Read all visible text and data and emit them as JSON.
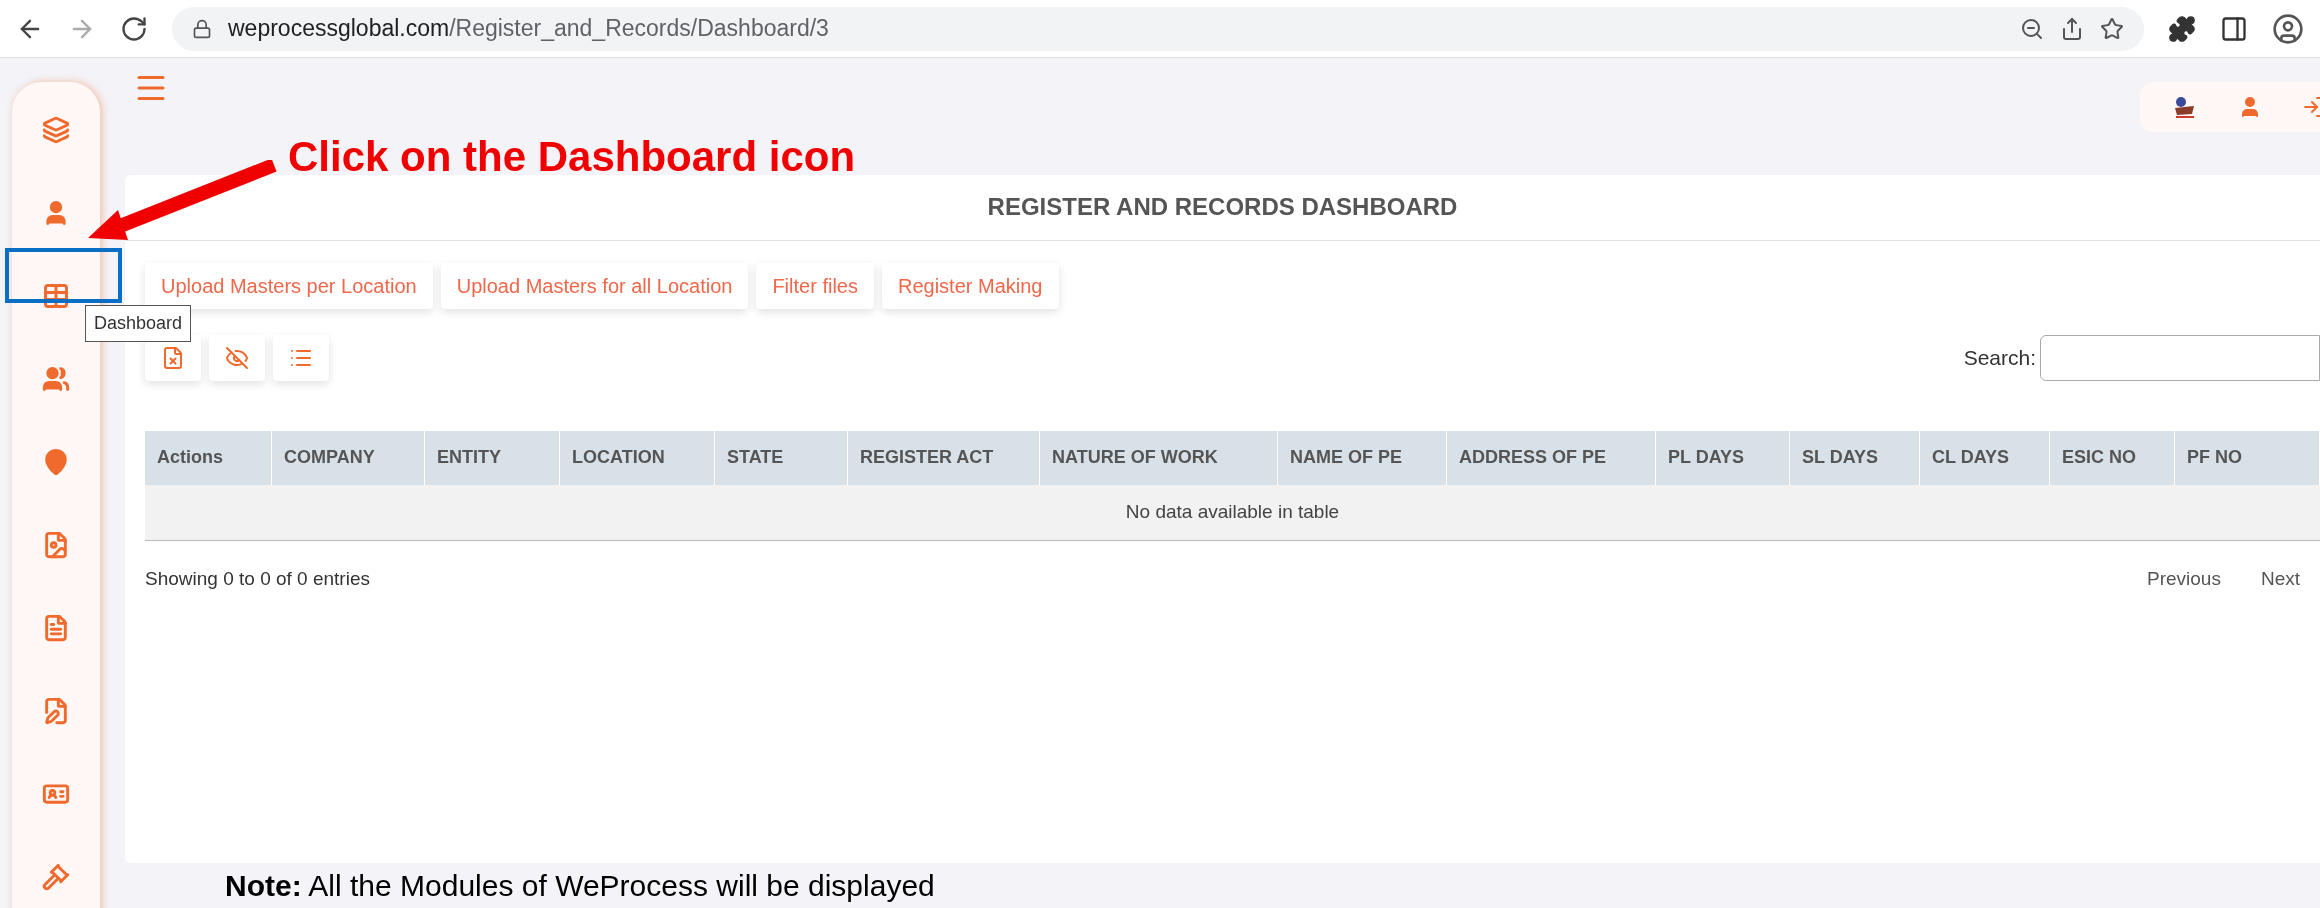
{
  "browser": {
    "url_host": "weprocessglobal.com",
    "url_path": "/Register_and_Records/Dashboard/3"
  },
  "sidebar": {
    "items": [
      {
        "kind": "layers"
      },
      {
        "kind": "user"
      },
      {
        "kind": "table"
      },
      {
        "kind": "users"
      },
      {
        "kind": "pin"
      },
      {
        "kind": "file-image"
      },
      {
        "kind": "file-text"
      },
      {
        "kind": "file-sign"
      },
      {
        "kind": "id-card"
      },
      {
        "kind": "gavel"
      }
    ],
    "tooltip": "Dashboard"
  },
  "annotation": {
    "callout": "Click on the Dashboard icon",
    "note": "**Note:** All the Modules of WeProcess will be displayed"
  },
  "dashboard": {
    "title": "REGISTER AND RECORDS DASHBOARD",
    "buttons": [
      "Upload Masters per Location",
      "Upload Masters for all Location",
      "Filter files",
      "Register Making"
    ],
    "tool_buttons": [
      {
        "kind": "excel"
      },
      {
        "kind": "hide"
      },
      {
        "kind": "list"
      }
    ],
    "search": {
      "label": "Search:"
    },
    "table": {
      "columns": [
        "Actions",
        "COMPANY",
        "ENTITY",
        "LOCATION",
        "STATE",
        "REGISTER ACT",
        "NATURE OF WORK",
        "NAME OF PE",
        "ADDRESS OF PE",
        "PL DAYS",
        "SL DAYS",
        "CL DAYS",
        "ESIC NO",
        "PF NO"
      ],
      "empty_message": "No data available in table"
    },
    "info": "Showing 0 to 0 of 0 entries",
    "pagination": [
      "Previous",
      "Next"
    ]
  }
}
